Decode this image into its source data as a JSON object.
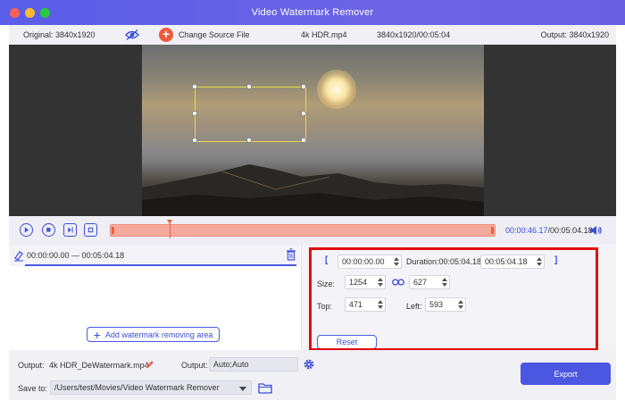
{
  "window": {
    "title": "Video Watermark Remover"
  },
  "infobar": {
    "original": "Original: 3840x1920",
    "change_source": "Change Source File",
    "file_name": "4k HDR.mp4",
    "file_info": "3840x1920/00:05:04",
    "output": "Output: 3840x1920"
  },
  "player": {
    "current_time": "00:00:46.17",
    "total_time": "/00:05:04.18"
  },
  "segment": {
    "range": "00:00:00.00 — 00:05:04.18"
  },
  "add_area_label": "Add watermark removing area",
  "settings": {
    "start_time": "00:00:00.00",
    "duration_label": "Duration:00:05:04.18",
    "end_time": "00:05:04.18",
    "size_label": "Size:",
    "width": "1254",
    "height": "627",
    "top_label": "Top:",
    "top": "471",
    "left_label": "Left:",
    "left": "593",
    "reset_label": "Reset"
  },
  "bottom": {
    "output_label": "Output:",
    "output_file": "4k HDR_DeWatermark.mp4",
    "output_format_label": "Output:",
    "output_format": "Auto;Auto",
    "save_to_label": "Save to:",
    "save_path": "/Users/test/Movies/Video Watermark Remover",
    "export_label": "Export"
  },
  "icons": {
    "eye": "eye-icon",
    "add": "plus-icon",
    "play": "play-icon",
    "stop": "stop-icon",
    "frame_prev": "frame-icon",
    "frame_next": "frame-icon",
    "volume": "volume-icon",
    "trash": "trash-icon",
    "eraser": "eraser-icon",
    "link": "link-icon",
    "pencil": "pencil-icon",
    "gear": "gear-icon",
    "folder": "folder-icon"
  },
  "colors": {
    "accent": "#4b57e0",
    "highlight": "#e10b10",
    "timeline": "#f5a99c"
  }
}
